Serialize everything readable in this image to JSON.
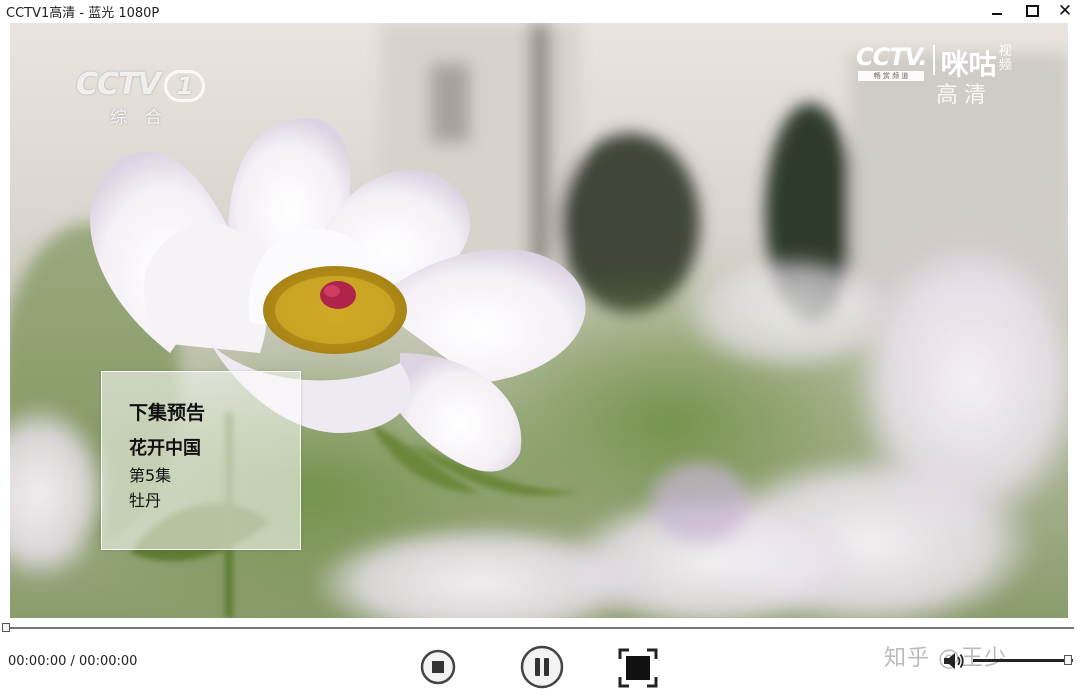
{
  "window": {
    "title": "CCTV1高清 - 蓝光 1080P",
    "minimize_glyph": "",
    "close_glyph": "✕"
  },
  "video": {
    "channel_logo": {
      "main": "CCTV",
      "number": "1",
      "sub": "综合"
    },
    "partner_logo": {
      "cctv": "CCTV.",
      "cctv_sub": "畅 赏 频 道",
      "brand": "咪咕",
      "brand_suffix": "视频",
      "quality": "高清"
    },
    "preview_panel": {
      "heading": "下集预告",
      "series": "花开中国",
      "episode": "第5集",
      "subject": "牡丹"
    }
  },
  "playback": {
    "time_display": "00:00:00 / 00:00:00",
    "progress_fraction": 0,
    "volume_fraction": 0.95
  },
  "watermark": "知乎 @王少",
  "icons": {
    "stop": "stop-icon",
    "pause": "pause-icon",
    "fullscreen": "fullscreen-icon",
    "volume": "speaker-icon",
    "minimize": "minimize-icon",
    "maximize": "maximize-icon",
    "close": "close-icon"
  },
  "colors": {
    "background": "#ffffff",
    "controls_icon": "#222222"
  }
}
